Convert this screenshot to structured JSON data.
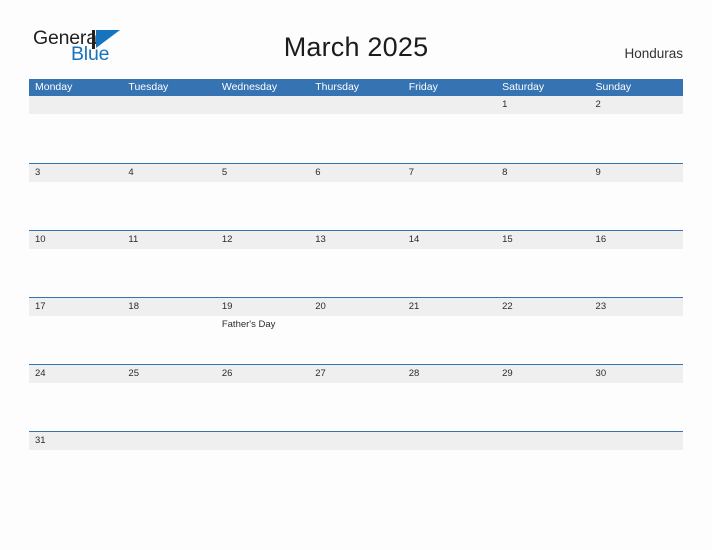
{
  "brand": {
    "name_part1": "General",
    "name_part2": "Blue",
    "flag_icon": "blue-triangle-flag-icon",
    "colors": {
      "general_text": "#221f1f",
      "blue_text": "#1673bd",
      "flag": "#1673bd"
    }
  },
  "header": {
    "title": "March 2025",
    "country": "Honduras"
  },
  "calendar": {
    "month": "March",
    "year": "2025",
    "colors": {
      "header_blue": "#3573b3",
      "row_band_gray": "#efefef",
      "row_rule_blue": "#3573b3",
      "page_background": "#fdfdfd",
      "text": "#2b2b2b"
    },
    "weekday_headers": [
      "Monday",
      "Tuesday",
      "Wednesday",
      "Thursday",
      "Friday",
      "Saturday",
      "Sunday"
    ],
    "weeks": [
      [
        {
          "date": "",
          "event": ""
        },
        {
          "date": "",
          "event": ""
        },
        {
          "date": "",
          "event": ""
        },
        {
          "date": "",
          "event": ""
        },
        {
          "date": "",
          "event": ""
        },
        {
          "date": "1",
          "event": ""
        },
        {
          "date": "2",
          "event": ""
        }
      ],
      [
        {
          "date": "3",
          "event": ""
        },
        {
          "date": "4",
          "event": ""
        },
        {
          "date": "5",
          "event": ""
        },
        {
          "date": "6",
          "event": ""
        },
        {
          "date": "7",
          "event": ""
        },
        {
          "date": "8",
          "event": ""
        },
        {
          "date": "9",
          "event": ""
        }
      ],
      [
        {
          "date": "10",
          "event": ""
        },
        {
          "date": "11",
          "event": ""
        },
        {
          "date": "12",
          "event": ""
        },
        {
          "date": "13",
          "event": ""
        },
        {
          "date": "14",
          "event": ""
        },
        {
          "date": "15",
          "event": ""
        },
        {
          "date": "16",
          "event": ""
        }
      ],
      [
        {
          "date": "17",
          "event": ""
        },
        {
          "date": "18",
          "event": ""
        },
        {
          "date": "19",
          "event": "Father's Day"
        },
        {
          "date": "20",
          "event": ""
        },
        {
          "date": "21",
          "event": ""
        },
        {
          "date": "22",
          "event": ""
        },
        {
          "date": "23",
          "event": ""
        }
      ],
      [
        {
          "date": "24",
          "event": ""
        },
        {
          "date": "25",
          "event": ""
        },
        {
          "date": "26",
          "event": ""
        },
        {
          "date": "27",
          "event": ""
        },
        {
          "date": "28",
          "event": ""
        },
        {
          "date": "29",
          "event": ""
        },
        {
          "date": "30",
          "event": ""
        }
      ],
      [
        {
          "date": "31",
          "event": ""
        },
        {
          "date": "",
          "event": ""
        },
        {
          "date": "",
          "event": ""
        },
        {
          "date": "",
          "event": ""
        },
        {
          "date": "",
          "event": ""
        },
        {
          "date": "",
          "event": ""
        },
        {
          "date": "",
          "event": ""
        }
      ]
    ]
  }
}
